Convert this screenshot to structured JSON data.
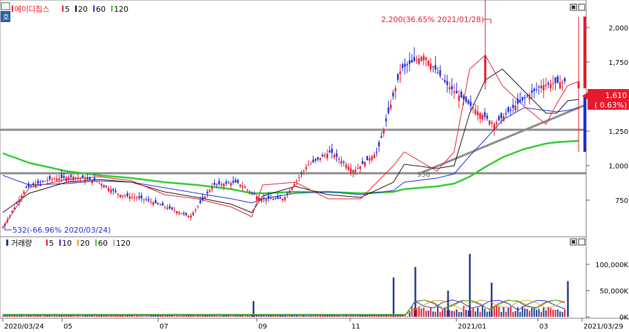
{
  "chart_data": [
    {
      "type": "candlestick",
      "title": "에이디칩스",
      "legend": [
        {
          "label": "5",
          "color": "#e8192c"
        },
        {
          "label": "20",
          "color": "#000000"
        },
        {
          "label": "60",
          "color": "#1c2bd8"
        },
        {
          "label": "120",
          "color": "#2ecc2e"
        }
      ],
      "y_ticks": [
        "2,000",
        "1,750",
        "1,500",
        "1,250",
        "1,000",
        "750"
      ],
      "y_tick_values": [
        2000,
        1750,
        1500,
        1250,
        1000,
        750
      ],
      "ylim": [
        500,
        2150
      ],
      "annotations": {
        "high_label": "2,200(36.65% 2021/01/28)",
        "low_label": "532(-66.96% 2020/03/24)",
        "mid_label": "956"
      },
      "current_price": {
        "value": "1,610",
        "change": "( 0.63%)",
        "color": "#e8192c"
      },
      "horizontal_lines": [
        1260,
        945
      ],
      "trendline": {
        "from": {
          "x": "2020/12/16",
          "y": 940
        },
        "to": {
          "x": "2021/03/29",
          "y": 1390
        }
      },
      "series_points": {
        "x": [
          "2020/03/24",
          "2020/04/10",
          "2020/05/04",
          "2020/05/25",
          "2020/06/15",
          "2020/07/06",
          "2020/07/27",
          "2020/08/18",
          "2020/08/31",
          "2020/09/07",
          "2020/09/28",
          "2020/10/19",
          "2020/11/09",
          "2020/11/30",
          "2020/12/07",
          "2020/12/28",
          "2021/01/08",
          "2021/01/18",
          "2021/01/28",
          "2021/02/08",
          "2021/02/22",
          "2021/03/08",
          "2021/03/15",
          "2021/03/22",
          "2021/03/29"
        ],
        "close": [
          550,
          840,
          900,
          920,
          890,
          790,
          760,
          700,
          630,
          860,
          880,
          760,
          760,
          1000,
          1100,
          960,
          1100,
          1700,
          1800,
          1580,
          1430,
          1300,
          1450,
          1580,
          1610
        ],
        "ma20": [
          660,
          800,
          880,
          900,
          880,
          810,
          770,
          720,
          660,
          780,
          850,
          790,
          770,
          880,
          1010,
          980,
          1000,
          1380,
          1620,
          1700,
          1540,
          1380,
          1380,
          1470,
          1480
        ],
        "ma60": [
          930,
          860,
          870,
          890,
          880,
          840,
          800,
          760,
          730,
          760,
          800,
          810,
          790,
          820,
          880,
          910,
          940,
          1070,
          1190,
          1330,
          1420,
          1400,
          1390,
          1400,
          1420
        ],
        "ma120": [
          1090,
          1020,
          960,
          930,
          910,
          880,
          860,
          830,
          800,
          800,
          810,
          810,
          800,
          810,
          830,
          850,
          870,
          920,
          990,
          1060,
          1120,
          1160,
          1170,
          1175,
          1180
        ]
      },
      "candle_highlights": [
        {
          "x": "2021/01/28",
          "high": 2200,
          "low": 1550,
          "open": 1600,
          "close": 1800
        },
        {
          "x": "2021/03/29",
          "high": 2080,
          "low": 1100,
          "open": 1560,
          "close": 1610
        }
      ]
    },
    {
      "type": "bar",
      "title": "거래량",
      "legend": [
        {
          "label": "5",
          "color": "#e8192c"
        },
        {
          "label": "10",
          "color": "#1c2bd8"
        },
        {
          "label": "20",
          "color": "#e0a020"
        },
        {
          "label": "60",
          "color": "#2ecc2e"
        },
        {
          "label": "120",
          "color": "#aaaaaa"
        }
      ],
      "y_ticks": [
        "100,000K",
        "50,000K",
        "0K"
      ],
      "y_tick_values": [
        100000,
        50000,
        0
      ],
      "ylim": [
        0,
        125000
      ],
      "spikes": [
        {
          "x": "2020/09/01",
          "value": 30000
        },
        {
          "x": "2020/11/30",
          "value": 75000
        },
        {
          "x": "2020/12/14",
          "value": 95000
        },
        {
          "x": "2021/01/04",
          "value": 50000
        },
        {
          "x": "2021/01/18",
          "value": 120000
        },
        {
          "x": "2021/02/01",
          "value": 65000
        },
        {
          "x": "2021/03/22",
          "value": 68000
        }
      ]
    }
  ],
  "x_axis": {
    "ticks": [
      "2020/03/24",
      "05",
      "07",
      "09",
      "11",
      "2021/01",
      "03",
      "2021/03/29"
    ]
  }
}
